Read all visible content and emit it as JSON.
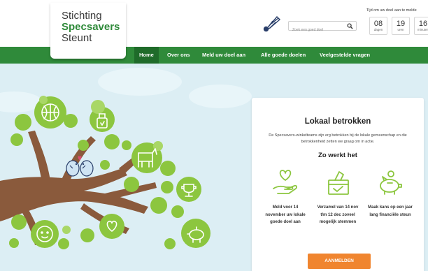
{
  "brand": {
    "line1": "Stichting",
    "line2": "Specsavers",
    "line3": "Steunt"
  },
  "search": {
    "placeholder": "Zoek een goed doel",
    "icon": "search-icon"
  },
  "countdown": {
    "label": "Tijd om uw doel aan te melde",
    "items": [
      {
        "value": "08",
        "unit": "dagen"
      },
      {
        "value": "19",
        "unit": "uren"
      },
      {
        "value": "16",
        "unit": "minuten"
      }
    ]
  },
  "nav": {
    "items": [
      {
        "label": "Home",
        "active": true
      },
      {
        "label": "Over ons",
        "active": false
      },
      {
        "label": "Meld uw doel aan",
        "active": false
      },
      {
        "label": "Alle goede doelen",
        "active": false
      },
      {
        "label": "Veelgestelde vragen",
        "active": false
      }
    ]
  },
  "card": {
    "title": "Lokaal betrokken",
    "description": "De Specsavers-winkelteams zijn erg betrokken bij de lokale gemeenschap en die betrokkenheid zetten we graag om in actie.",
    "subtitle": "Zo werkt het",
    "steps": [
      {
        "icon": "heart-hand-icon",
        "text": "Meld voor 14 november uw lokale goede doel aan"
      },
      {
        "icon": "ballot-box-icon",
        "text": "Verzamel van 14 nov t/m 12 dec zoveel mogelijk stemmen"
      },
      {
        "icon": "piggy-bank-icon",
        "text": "Maak kans op een jaar lang financiële steun"
      }
    ],
    "cta": "AANMELDEN"
  },
  "colors": {
    "green": "#2f8a3a",
    "nav_active": "#1f6b2a",
    "leaf": "#8cc63f",
    "branch": "#8a5a3c",
    "sky": "#dceef4",
    "cta": "#f0852f"
  }
}
